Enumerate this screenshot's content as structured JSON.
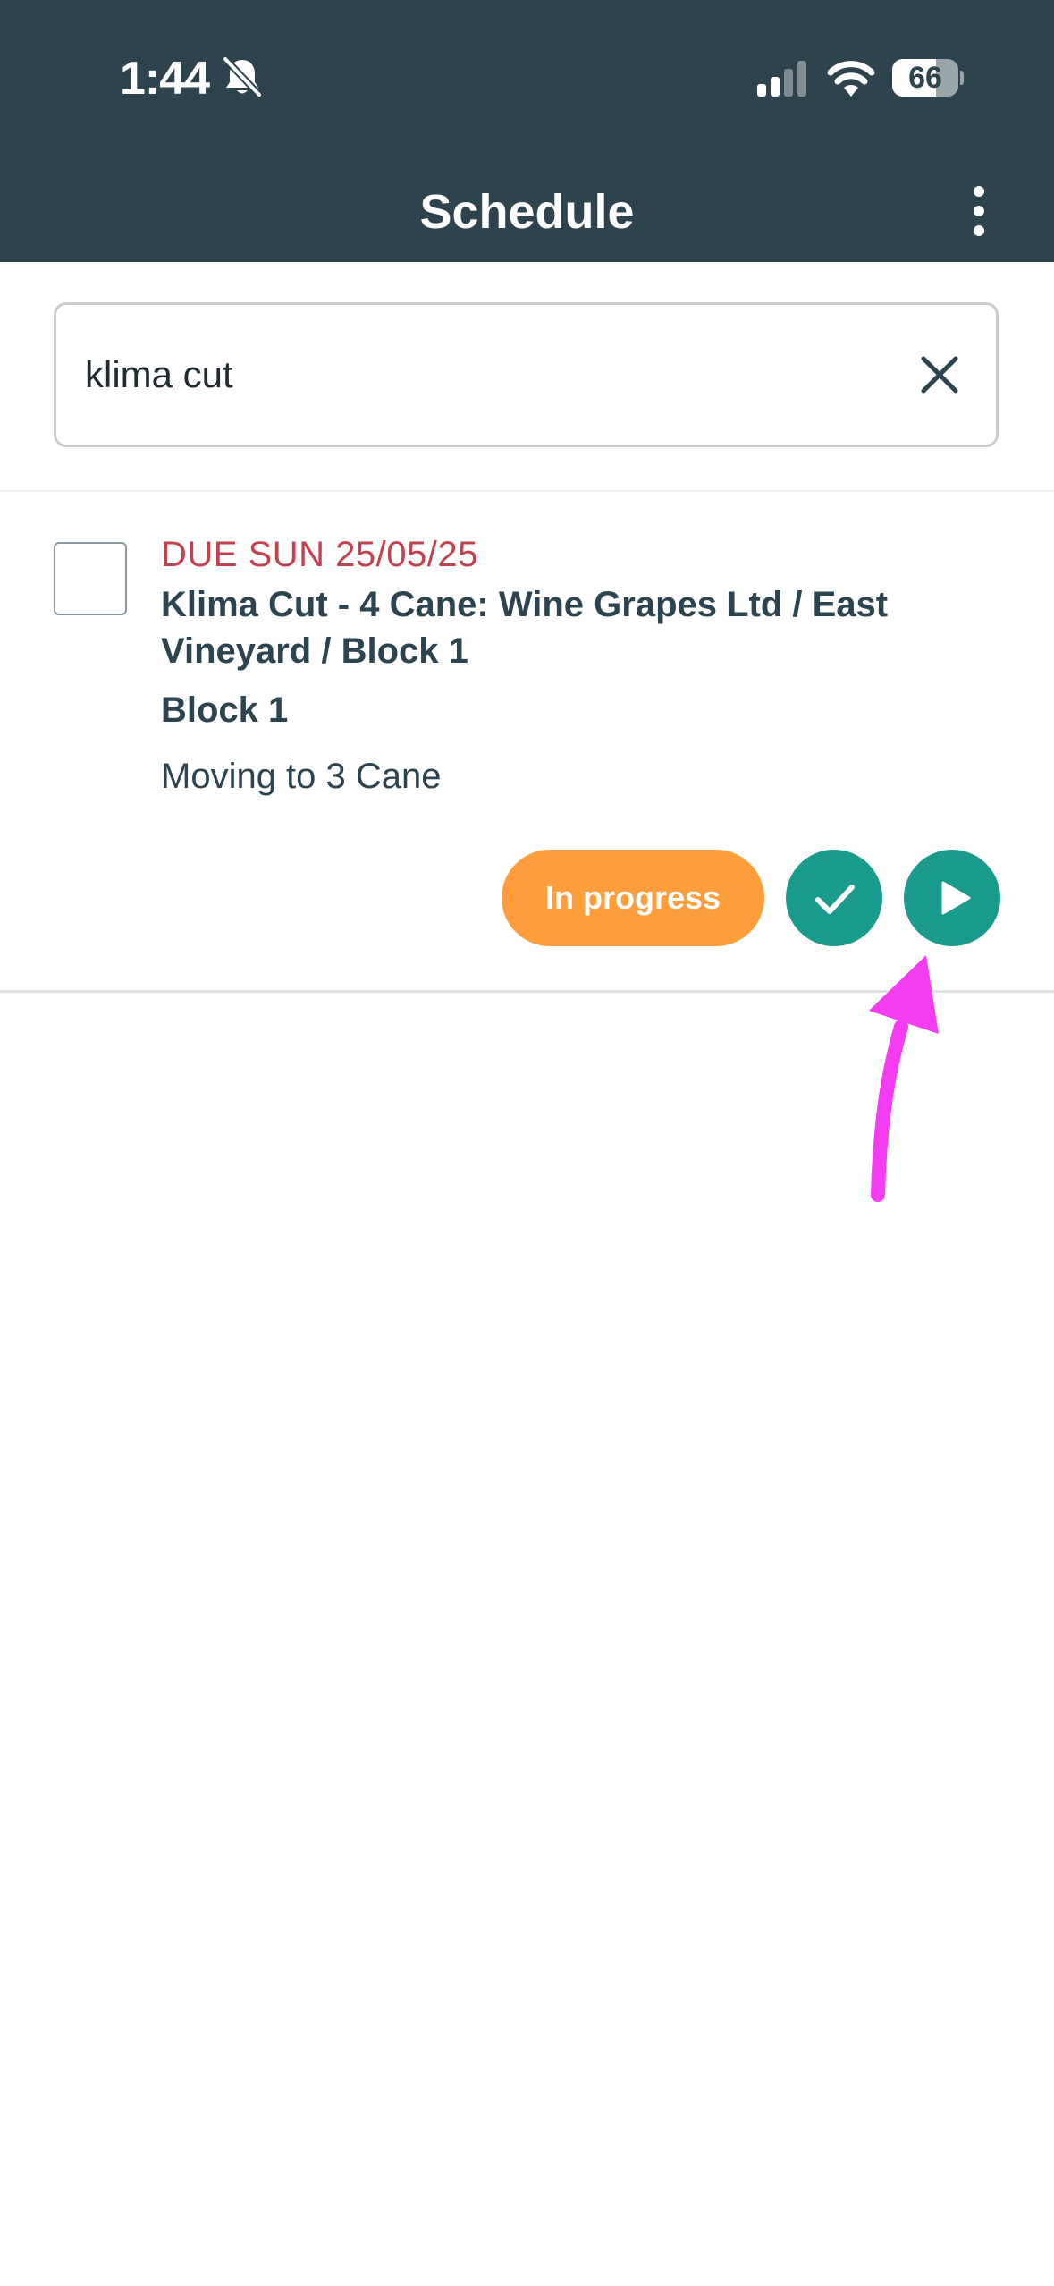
{
  "status_bar": {
    "time": "1:44",
    "battery_level": "66",
    "battery_fraction": 0.66,
    "icons": [
      "bell-slash-icon",
      "cellular-signal-icon",
      "wifi-icon",
      "battery-icon"
    ]
  },
  "header": {
    "title": "Schedule",
    "menu_icon": "more-vertical-icon"
  },
  "search": {
    "value": "klima cut",
    "clear_icon": "close-icon"
  },
  "tasks": [
    {
      "due": "DUE SUN 25/05/25",
      "title": "Klima Cut - 4 Cane: Wine Grapes Ltd / East Vineyard / Block 1",
      "block": "Block 1",
      "note": "Moving to 3 Cane",
      "status": "In progress",
      "actions": [
        "check-icon",
        "play-icon"
      ]
    }
  ],
  "colors": {
    "header_bg": "#2d444f",
    "due_text": "#c2414f",
    "status_pill": "#fd9d3b",
    "action_button": "#1a9a8d",
    "annotation_arrow": "#f43df2"
  },
  "annotation": {
    "type": "arrow",
    "points_to": "start-button"
  }
}
